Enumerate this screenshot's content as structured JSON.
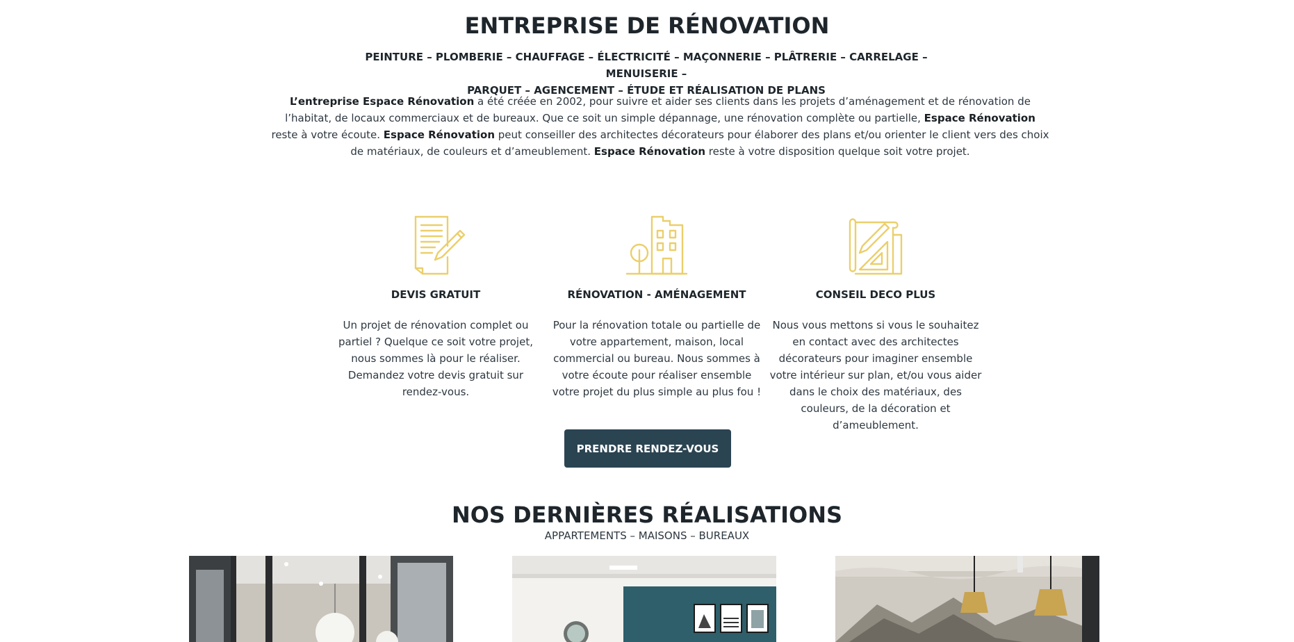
{
  "header": {
    "title": "ENTREPRISE DE RÉNOVATION",
    "services_line1": "PEINTURE – PLOMBERIE – CHAUFFAGE – ÉLECTRICITÉ – MAÇONNERIE – PLÂTRERIE – CARRELAGE – MENUISERIE –",
    "services_line2": "PARQUET – AGENCEMENT – ÉTUDE ET RÉALISATION DE PLANS"
  },
  "intro": {
    "p1_bold": "L’entreprise Espace Rénovation",
    "p1_text": " a été créée en 2002, pour suivre et aider ses clients dans les projets d’aménagement et de rénovation de l’habitat, de locaux commerciaux et de bureaux. Que ce soit un simple dépannage, une rénovation complète ou partielle, ",
    "p2_bold": "Espace Rénovation",
    "p2_text": " reste à votre écoute. ",
    "p3_bold": "Espace Rénovation",
    "p3_text": " peut conseiller des architectes décorateurs pour élaborer des plans et/ou orienter le client vers des choix de matériaux, de couleurs et d’ameublement. ",
    "p4_bold": "Espace Rénovation",
    "p4_text": " reste à votre disposition quelque soit votre projet."
  },
  "features": [
    {
      "icon": "document-pencil-icon",
      "title": "DEVIS GRATUIT",
      "text": "Un projet de rénovation complet ou partiel ? Quelque ce soit votre projet, nous sommes là pour le réaliser. Demandez votre devis gratuit sur rendez-vous."
    },
    {
      "icon": "building-tree-icon",
      "title": "RÉNOVATION - AMÉNAGEMENT",
      "text": "Pour la rénovation totale ou partielle de votre appartement, maison, local commercial ou bureau. Nous sommes à votre écoute pour réaliser ensemble votre projet du plus simple au plus fou !"
    },
    {
      "icon": "blueprint-ruler-icon",
      "title": "CONSEIL DECO PLUS",
      "text": "Nous vous mettons si vous le souhaitez en contact avec des architectes décorateurs pour imaginer ensemble votre intérieur sur plan, et/ou vous aider dans le choix des matériaux, des couleurs, de la décoration et d’ameublement."
    }
  ],
  "cta": {
    "label": "PRENDRE RENDEZ-VOUS"
  },
  "realisations": {
    "title": "NOS DERNIÈRES RÉALISATIONS",
    "subtitle": "APPARTEMENTS – MAISONS – BUREAUX"
  },
  "colors": {
    "icon_gold": "#ebcf6b",
    "button_bg": "#2b4452",
    "text_dark": "#1e262c"
  }
}
